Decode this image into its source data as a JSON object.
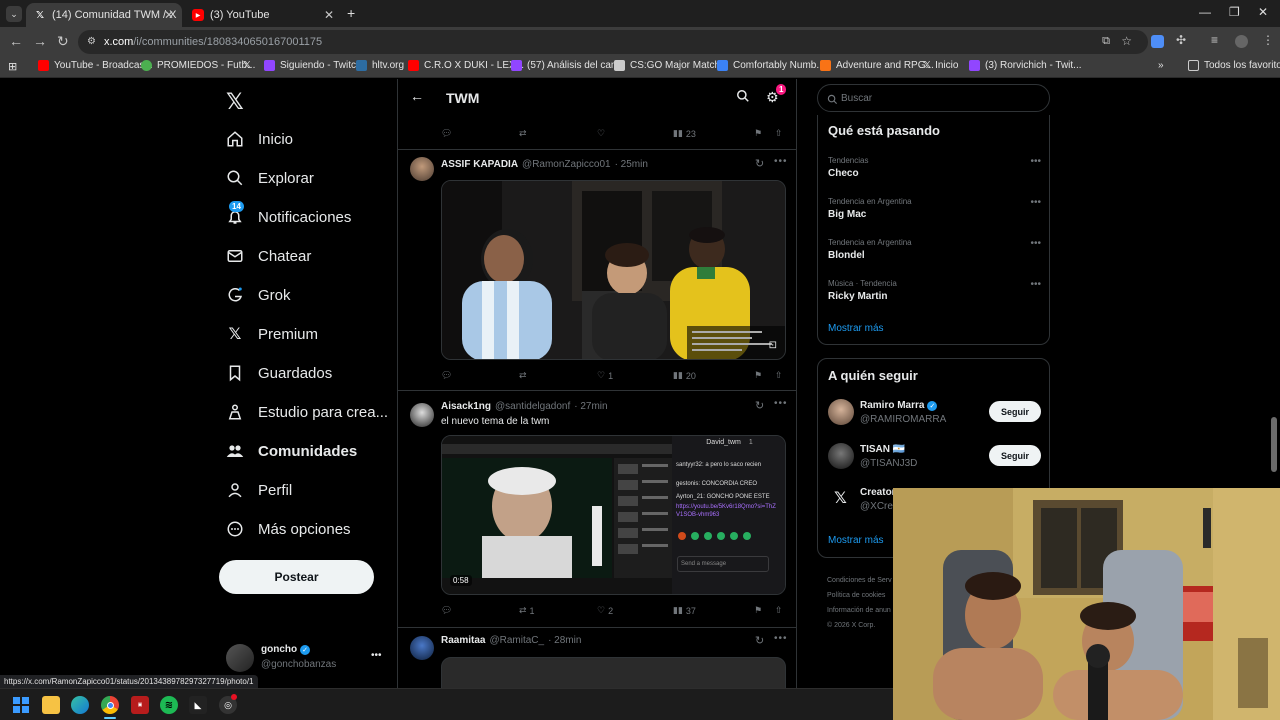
{
  "browser": {
    "tabs": [
      {
        "title": "(14) Comunidad TWM / X",
        "active": true
      },
      {
        "title": "(3) YouTube",
        "active": false
      }
    ],
    "new_tab": "+",
    "url_host": "x.com",
    "url_path": "/i/communities/1808340650167001175",
    "bookmarks": [
      {
        "label": "YouTube - Broadcas...",
        "color": "#ff0000"
      },
      {
        "label": "PROMIEDOS - Futb...",
        "color": "#4caf50"
      },
      {
        "label": "",
        "color": "#e7e9ea"
      },
      {
        "label": "Siguiendo - Twitch",
        "color": "#9146ff"
      },
      {
        "label": "hltv.org",
        "color": "#2d6da3"
      },
      {
        "label": "C.R.O X DUKI - LEX...",
        "color": "#ff0000"
      },
      {
        "label": "(57) Análisis del can...",
        "color": "#9146ff"
      },
      {
        "label": "CS:GO Major Match...",
        "color": "#cccccc"
      },
      {
        "label": "Comfortably Numb...",
        "color": "#3b82f6"
      },
      {
        "label": "Adventure and RPG...",
        "color": "#f97316"
      },
      {
        "label": "Inicio",
        "color": "#e7e9ea"
      },
      {
        "label": "(3) Rorvichich - Twit...",
        "color": "#9146ff"
      }
    ],
    "bookmarks_more": "»",
    "all_favorites": "Todos los favoritos",
    "status_url": "https://x.com/RamonZapicco01/status/2013438978297327719/photo/1"
  },
  "sidebar": {
    "items": [
      {
        "label": "Inicio",
        "icon": "home-icon"
      },
      {
        "label": "Explorar",
        "icon": "search-icon"
      },
      {
        "label": "Notificaciones",
        "icon": "bell-icon",
        "badge": "14"
      },
      {
        "label": "Chatear",
        "icon": "mail-icon"
      },
      {
        "label": "Grok",
        "icon": "grok-icon"
      },
      {
        "label": "Premium",
        "icon": "x-logo-icon"
      },
      {
        "label": "Guardados",
        "icon": "bookmark-icon"
      },
      {
        "label": "Estudio para crea...",
        "icon": "studio-icon"
      },
      {
        "label": "Comunidades",
        "icon": "communities-icon",
        "active": true
      },
      {
        "label": "Perfil",
        "icon": "profile-icon"
      },
      {
        "label": "Más opciones",
        "icon": "more-icon"
      }
    ],
    "post_button": "Postear",
    "account": {
      "name": "goncho",
      "handle": "@gonchobanzas"
    }
  },
  "feed": {
    "title": "TWM",
    "settings_badge": "1",
    "top_tweet_views": "23",
    "tweets": [
      {
        "name": "ASSIF KAPADIA",
        "handle": "@RamonZapicco01",
        "time": "· 25min",
        "text": "",
        "replies": "",
        "retweets": "",
        "likes": "1",
        "views": "20"
      },
      {
        "name": "Aisack1ng",
        "handle": "@santidelgadonf",
        "time": "· 27min",
        "text": "el nuevo tema de la twm",
        "replies": "",
        "retweets": "1",
        "likes": "2",
        "views": "37",
        "video_duration": "0:58",
        "chat": {
          "channel": "David_twm",
          "viewers": "1",
          "lines": [
            "santyyr32: a pero lo saco recien",
            "gestonis: CONCORDIA CREO",
            "Ayrton_21: GONCHO PONE ESTE",
            "https://youtu.be/5Kv6r18Qmo?si=ThZV1SOB-vhm963"
          ],
          "input_placeholder": "Send a message"
        }
      },
      {
        "name": "Raamitaa",
        "handle": "@RamitaC_",
        "time": "· 28min",
        "text": ""
      }
    ]
  },
  "right": {
    "search_placeholder": "Buscar",
    "trends_title": "Qué está pasando",
    "trends": [
      {
        "meta": "Tendencias",
        "name": "Checo"
      },
      {
        "meta": "Tendencia en Argentina",
        "name": "Big Mac"
      },
      {
        "meta": "Tendencia en Argentina",
        "name": "Blondel"
      },
      {
        "meta": "Música · Tendencia",
        "name": "Ricky Martin"
      }
    ],
    "show_more": "Mostrar más",
    "follow_title": "A quién seguir",
    "follow": [
      {
        "name": "Ramiro Marra",
        "handle": "@RAMIROMARRA",
        "button": "Seguir"
      },
      {
        "name": "TISAN 🇦🇷",
        "handle": "@TISANJ3D",
        "button": "Seguir"
      },
      {
        "name": "Creator",
        "handle": "@XCrea"
      }
    ],
    "show_more_2": "Mostrar más",
    "footer": [
      "Condiciones de Serv",
      "Política de cookies",
      "Información de anun",
      "© 2026 X Corp."
    ]
  }
}
